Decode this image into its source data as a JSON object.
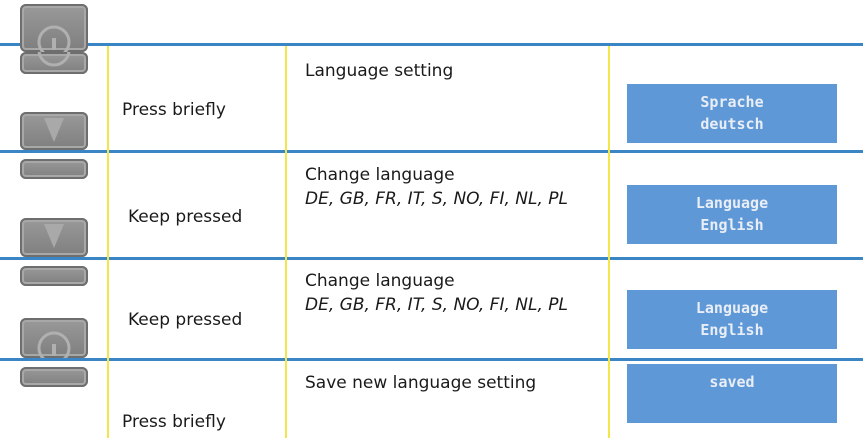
{
  "rows": [
    {
      "action": "Press briefly",
      "description": "Language setting",
      "description_detail": "",
      "display_line1": "Sprache",
      "display_line2": "deutsch"
    },
    {
      "action": "Keep pressed",
      "description": "Change language",
      "description_detail": "DE, GB, FR, IT, S, NO, FI, NL, PL",
      "display_line1": "Language",
      "display_line2": "English"
    },
    {
      "action": "Keep pressed",
      "description": "Change language",
      "description_detail": "DE, GB, FR, IT, S, NO, FI, NL, PL",
      "display_line1": "Language",
      "display_line2": "English"
    },
    {
      "action": "Press briefly",
      "description": "Save new language setting",
      "description_detail": "",
      "display_line1": "saved",
      "display_line2": ""
    }
  ],
  "icons": [
    "info-button-icon",
    "down-arrow-button-icon",
    "down-arrow-button-icon",
    "info-button-icon"
  ],
  "colors": {
    "row_divider": "#3a86c4",
    "column_divider": "#f2e64a",
    "display_background": "#5f98d6",
    "display_text": "#e9eef6",
    "button_gray": "#8a8a8a"
  }
}
